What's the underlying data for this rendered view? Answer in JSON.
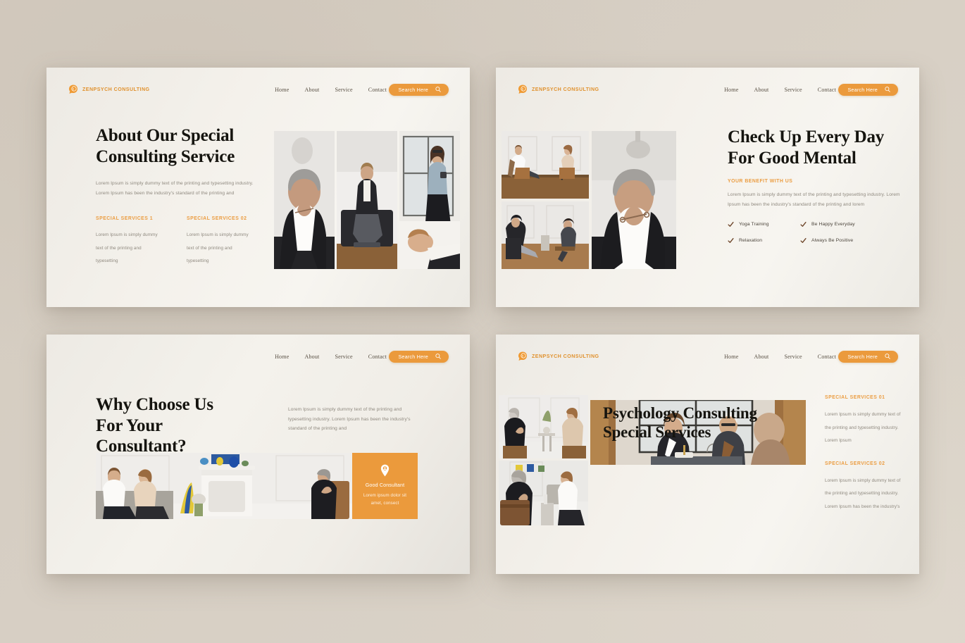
{
  "brand": {
    "name": "ZENPSYCH CONSULTING",
    "logo_icon": "head-profile-icon"
  },
  "nav": {
    "links": [
      "Home",
      "About",
      "Service",
      "Contact"
    ],
    "search_label": "Search Here",
    "search_icon": "search-icon"
  },
  "colors": {
    "accent_orange": "#eb9a3c",
    "eyebrow_orange": "#eb9d42",
    "heading_dark": "#15140f",
    "body_gray": "#8e887e",
    "check_brown": "#6b4226",
    "page_background": "#d5ccc1",
    "slide_background": "#f4f1eb"
  },
  "slide1": {
    "headline": "About Our Special Consulting Service",
    "paragraph": "Lorem Ipsum is simply dummy text of the printing and typesetting industry. Lorem Ipsum has been the industry's standard of the printing and",
    "columns": [
      {
        "title": "SPECIAL SERVICES 1",
        "text": "Lorem Ipsum is simply dummy text of the printing and typesetting"
      },
      {
        "title": "SPECIAL SERVICES 02",
        "text": "Lorem Ipsum is simply dummy text of the printing and typesetting"
      }
    ],
    "photos": [
      "woman-with-glasses-portrait",
      "man-sitting-on-sofa",
      "woman-standing-by-window"
    ]
  },
  "slide2": {
    "headline": "Check Up Every Day For Good Mental",
    "eyebrow": "YOUR BENEFIT WITH US",
    "paragraph": "Lorem Ipsum is simply dummy text of the printing and typesetting industry. Lorem Ipsum has been the industry's standard of the printing and lorem",
    "benefits": [
      "Yoga Training",
      "Be Happy Everyday",
      "Relaxation",
      "Always Be Positive"
    ],
    "check_icon": "check-mark-icon",
    "photos": [
      "two-people-on-chairs-session",
      "therapy-session-two-men",
      "woman-with-glasses-portrait"
    ]
  },
  "slide3": {
    "headline": "Why Choose Us For Your Consultant?",
    "paragraph": "Lorem Ipsum is simply dummy text of the printing and typesetting industry. Lorem Ipsum has been the industry's standard of the printing and",
    "card": {
      "icon": "location-pin-icon",
      "title": "Good Consultant",
      "text": "Lorem ipsum dolor sit amet, consect"
    },
    "photo": "couple-counselling-wide-room"
  },
  "slide4": {
    "headline": "Psychology Consulting Special Services",
    "sections": [
      {
        "title": "SPECIAL SERVICES 01",
        "text": "Lorem Ipsum is simply dummy text of the printing and typesetting industry. Lorem Ipsum"
      },
      {
        "title": "SPECIAL SERVICES 02",
        "text": "Lorem Ipsum is simply dummy text of the printing and typesetting industry. Lorem Ipsum has been the industry's"
      }
    ],
    "photos": [
      "two-women-talking-session",
      "man-and-woman-consultation",
      "meeting-at-window-table"
    ]
  }
}
